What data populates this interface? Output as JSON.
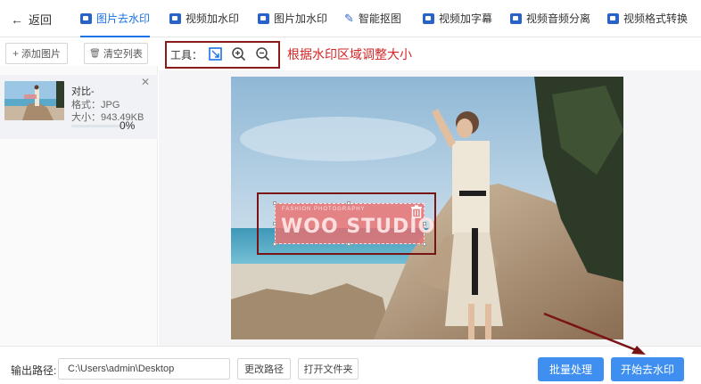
{
  "nav": {
    "back_label": "返回",
    "items": [
      {
        "label": "图片去水印",
        "active": true
      },
      {
        "label": "视频加水印",
        "active": false
      },
      {
        "label": "图片加水印",
        "active": false
      },
      {
        "label": "智能抠图",
        "active": false
      },
      {
        "label": "视频加字幕",
        "active": false
      },
      {
        "label": "视频音频分离",
        "active": false
      },
      {
        "label": "视频格式转换",
        "active": false
      }
    ]
  },
  "left": {
    "add_label": "添加图片",
    "clear_label": "清空列表",
    "file": {
      "name": "对比-",
      "format": "格式：JPG",
      "size": "大小：943.49KB",
      "progress": "0%",
      "progress_value": 0
    }
  },
  "tools": {
    "label": "工具：",
    "annotation": "根据水印区域调整大小"
  },
  "watermark": {
    "text": "WOO STUDIO",
    "subtext": "FASHION PHOTOGRAPHY"
  },
  "bottom": {
    "output_label": "输出路径:",
    "output_path": "C:\\Users\\admin\\Desktop",
    "change_path": "更改路径",
    "open_folder": "打开文件夹",
    "batch": "批量处理",
    "start": "开始去水印"
  },
  "colors": {
    "accent": "#1a73e8",
    "primary_button": "#3f8ff0",
    "annotation_red": "#d42424",
    "highlight_box": "#8b1a1a"
  }
}
